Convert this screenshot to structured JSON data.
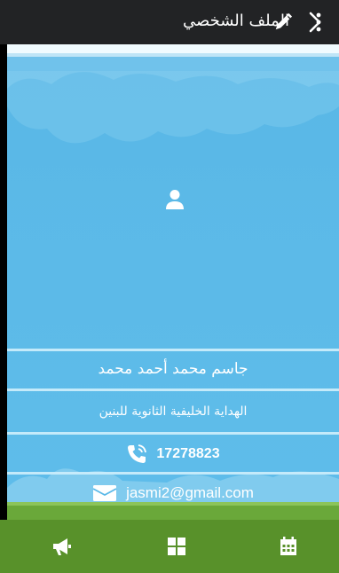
{
  "header": {
    "title": "الملف الشخصي",
    "back_icon": "chevron-right-icon",
    "edit_icon": "pencil-icon",
    "more_icon": "more-vertical-icon"
  },
  "profile": {
    "avatar_icon": "user-icon",
    "name": "جاسم محمد أحمد محمد",
    "school": "الهداية الخليفية الثانوية للبنين",
    "phone": "17278823",
    "phone_icon": "phone-icon",
    "email": "jasmi2@gmail.com",
    "email_icon": "envelope-icon"
  },
  "bottom_nav": {
    "items": [
      {
        "icon": "megaphone-icon"
      },
      {
        "icon": "grid-icon"
      },
      {
        "icon": "calendar-icon"
      }
    ]
  },
  "colors": {
    "topbar": "#222325",
    "sky": "#5bb9e8",
    "bottombar": "#58912a"
  }
}
